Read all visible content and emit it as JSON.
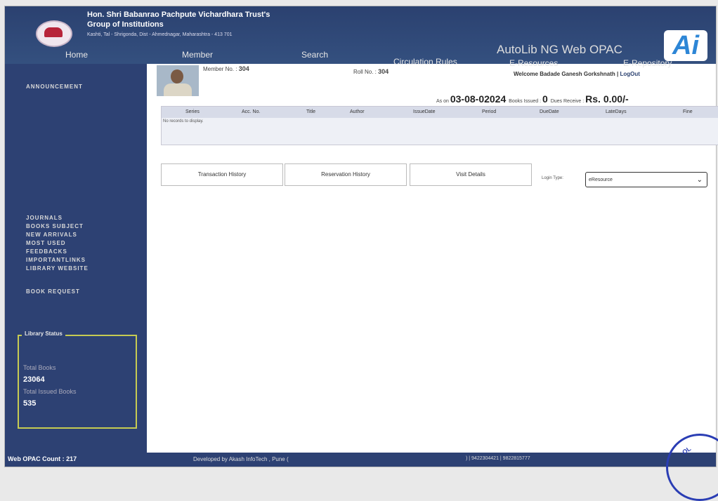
{
  "header": {
    "trust_name": "Hon. Shri Babanrao Pachpute Vichardhara Trust's",
    "group": "Group of Institutions",
    "address": "Kashti, Tal - Shrigonda, Dist - Ahmednagar, Maharashtra - 413 701",
    "brand": "AutoLib NG Web OPAC",
    "logo_icon": "ai-logo-icon"
  },
  "nav": [
    "Home",
    "Member",
    "Search",
    "Circulation Rules",
    "E-Resources",
    "E-Repository"
  ],
  "sidebar": {
    "announcement": "ANNOUNCEMENT",
    "links": [
      "JOURNALS",
      "BOOKS SUBJECT",
      "NEW ARRIVALS",
      "MOST USED",
      "FEEDBACKS",
      "IMPORTANTLINKS",
      "LIBRARY WEBSITE"
    ],
    "book_request": "BOOK REQUEST",
    "library_status": {
      "title": "Library Status",
      "total_books_label": "Total Books",
      "total_books": "23064",
      "issued_label": "Total Issued Books",
      "issued": "535"
    }
  },
  "member": {
    "member_no_label": "Member No. :",
    "member_no": "304",
    "roll_no_label": "Roll No. :",
    "roll_no": "304",
    "welcome": "Welcome Badade Ganesh Gorkshnath",
    "logout": "LogOut",
    "as_on_label": "As on",
    "as_on": "03-08-02024",
    "books_issued_label": "Books Issued :",
    "books_issued": "0",
    "dues_label": "Dues Receive :",
    "dues": "Rs. 0.00/-"
  },
  "table": {
    "headers": [
      "Series",
      "Acc. No.",
      "Title",
      "Author",
      "IssueDate",
      "Period",
      "DueDate",
      "LateDays",
      "Fine"
    ],
    "empty": "No records to display."
  },
  "tabs": [
    "Transaction History",
    "Reservation History",
    "Visit Details"
  ],
  "login_type": {
    "label": "Login Type:",
    "selected": "eResource"
  },
  "footer": {
    "count": "Web OPAC Count : 217",
    "developer": "Developed by Akash InfoTech , Pune (",
    "phones": ") | 9422304421 | 9822815777"
  },
  "stamp_text": "OL"
}
